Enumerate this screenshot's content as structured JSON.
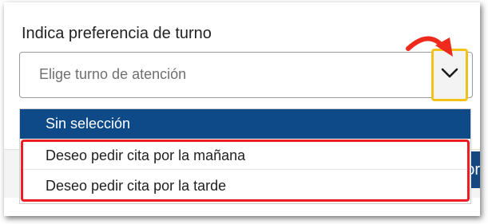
{
  "form": {
    "label": "Indica preferencia de turno",
    "select": {
      "placeholder": "Elige turno de atención",
      "options": [
        {
          "label": "Sin selección",
          "selected": true
        },
        {
          "label": "Deseo pedir cita por la mañana",
          "selected": false
        },
        {
          "label": "Deseo pedir cita por la tarde",
          "selected": false
        }
      ]
    }
  },
  "background_button": {
    "partial_label": "or"
  },
  "icons": {
    "toggle": "chevron-down-icon",
    "callout": "curved-arrow-icon"
  },
  "colors": {
    "selected_option": "#0e4a87",
    "toggle_highlight": "#f2c21b",
    "options_highlight": "#ee1c24",
    "callout_arrow": "#ee2a1c"
  }
}
